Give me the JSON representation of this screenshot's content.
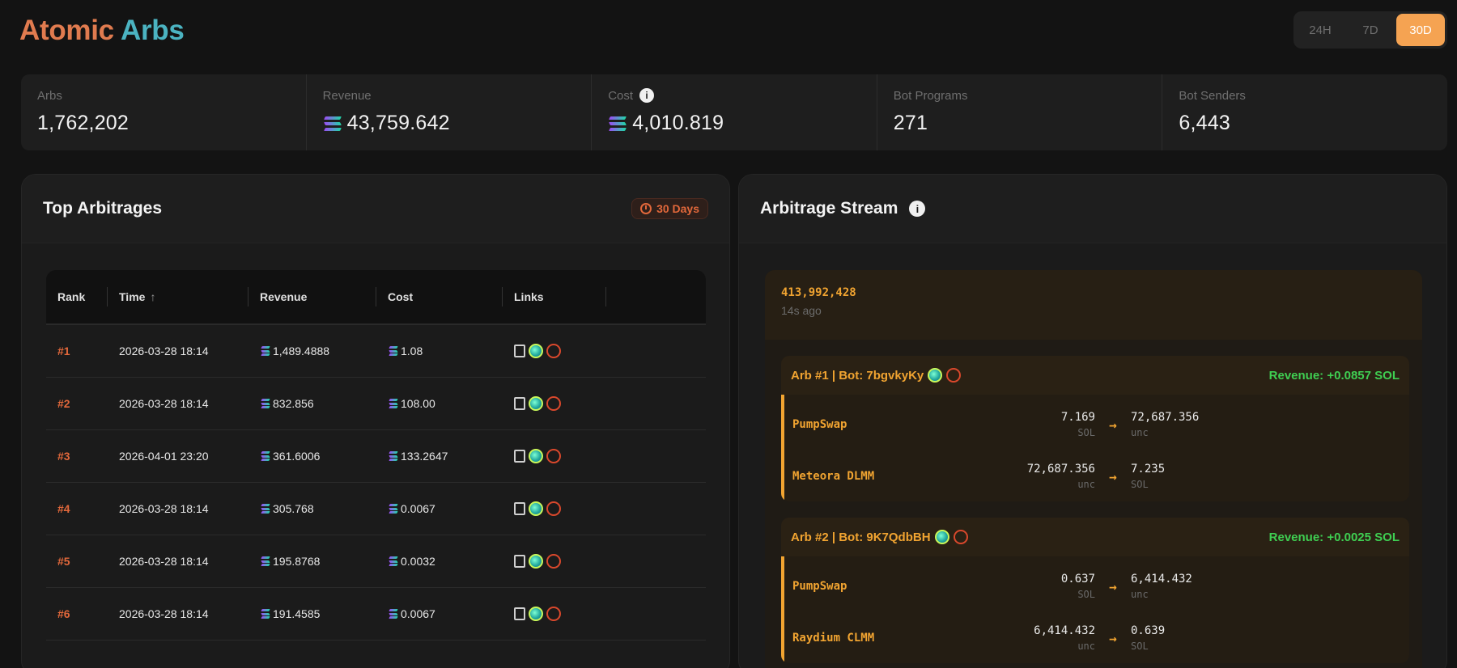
{
  "brand": {
    "part1": "Atomic",
    "part2": "Arbs"
  },
  "range": {
    "options": [
      "24H",
      "7D",
      "30D"
    ],
    "active": "30D"
  },
  "stats": [
    {
      "label": "Arbs",
      "value": "1,762,202"
    },
    {
      "label": "Revenue",
      "value": "43,759.642"
    },
    {
      "label": "Cost",
      "value": "4,010.819"
    },
    {
      "label": "Bot Programs",
      "value": "271"
    },
    {
      "label": "Bot Senders",
      "value": "6,443"
    }
  ],
  "top": {
    "title": "Top Arbitrages",
    "badge": "30 Days",
    "columns": {
      "rank": "Rank",
      "time": "Time",
      "revenue": "Revenue",
      "cost": "Cost",
      "links": "Links"
    },
    "rows": [
      {
        "rank": "#1",
        "time": "2026-03-28 18:14",
        "revenue": "1,489.4888",
        "cost": "1.08"
      },
      {
        "rank": "#2",
        "time": "2026-03-28 18:14",
        "revenue": "832.856",
        "cost": "108.00"
      },
      {
        "rank": "#3",
        "time": "2026-04-01 23:20",
        "revenue": "361.6006",
        "cost": "133.2647"
      },
      {
        "rank": "#4",
        "time": "2026-03-28 18:14",
        "revenue": "305.768",
        "cost": "0.0067"
      },
      {
        "rank": "#5",
        "time": "2026-03-28 18:14",
        "revenue": "195.8768",
        "cost": "0.0032"
      },
      {
        "rank": "#6",
        "time": "2026-03-28 18:14",
        "revenue": "191.4585",
        "cost": "0.0067"
      }
    ]
  },
  "stream": {
    "title": "Arbitrage Stream",
    "slot": "413,992,428",
    "ago": "14s ago",
    "arbs": [
      {
        "title": "Arb #1 | Bot: 7bgvkyKy",
        "revenue": "Revenue: +0.0857 SOL",
        "hops": [
          {
            "dex": "PumpSwap",
            "in": "7.169",
            "in_unit": "SOL",
            "out": "72,687.356",
            "out_unit": "unc"
          },
          {
            "dex": "Meteora DLMM",
            "in": "72,687.356",
            "in_unit": "unc",
            "out": "7.235",
            "out_unit": "SOL"
          }
        ]
      },
      {
        "title": "Arb #2 | Bot: 9K7QdbBH",
        "revenue": "Revenue: +0.0025 SOL",
        "hops": [
          {
            "dex": "PumpSwap",
            "in": "0.637",
            "in_unit": "SOL",
            "out": "6,414.432",
            "out_unit": "unc"
          },
          {
            "dex": "Raydium CLMM",
            "in": "6,414.432",
            "in_unit": "unc",
            "out": "0.639",
            "out_unit": "SOL"
          }
        ]
      }
    ]
  }
}
